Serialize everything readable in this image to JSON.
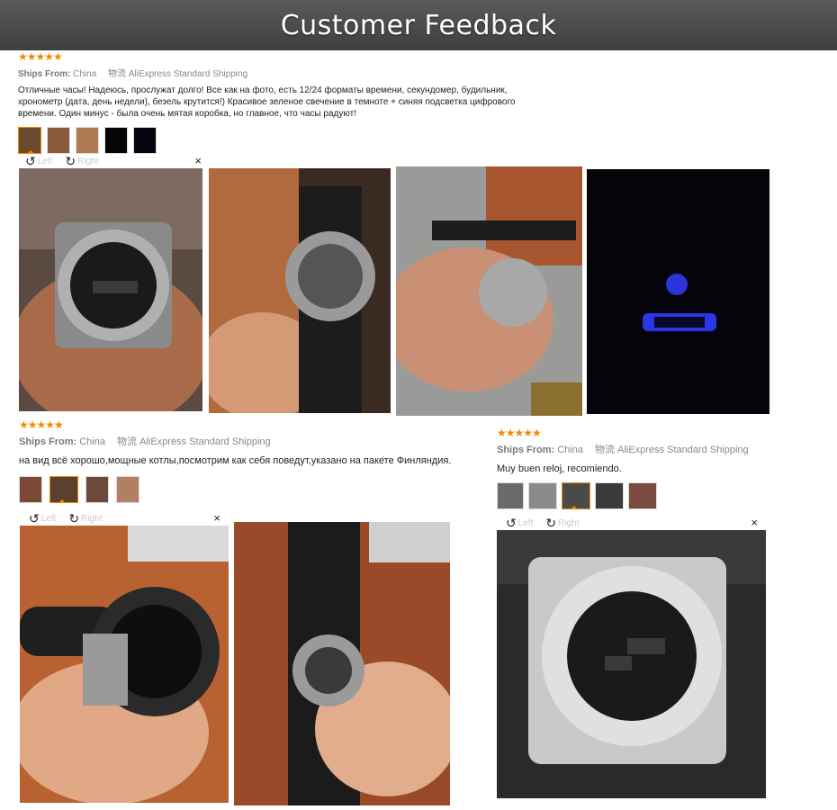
{
  "banner": {
    "title": "Customer Feedback"
  },
  "colors": {
    "accent": "#f08b00",
    "banner": "#4a4a4a"
  },
  "viewer": {
    "left": "Left",
    "right": "Right",
    "close": "×"
  },
  "reviews": [
    {
      "stars": "★★★★★",
      "ships_label": "Ships From:",
      "ships_from": "China",
      "shipping": "物流 AliExpress Standard Shipping",
      "text": "Отличные часы! Надеюсь, прослужат долго! Все как на фото, есть 12/24 форматы времени, секундомер, будильник, хронометр (дата, день недели), безель крутится!) Красивое зеленое свечение в темноте + синяя подсветка цифрового времени. Один минус - была очень мятая коробка, но главное, что часы радуют!"
    },
    {
      "stars": "★★★★★",
      "ships_label": "Ships From:",
      "ships_from": "China",
      "shipping": "物流 AliExpress Standard Shipping",
      "text": "на вид всё хорошо,мощные котлы,посмотрим как себя поведут,указано на пакете Финляндия."
    },
    {
      "stars": "★★★★★",
      "ships_label": "Ships From:",
      "ships_from": "China",
      "shipping": "物流 AliExpress Standard Shipping",
      "text": "Muy buen reloj, recomiendo."
    }
  ],
  "icons": {
    "rotate_left": "↺",
    "rotate_right": "↻"
  }
}
